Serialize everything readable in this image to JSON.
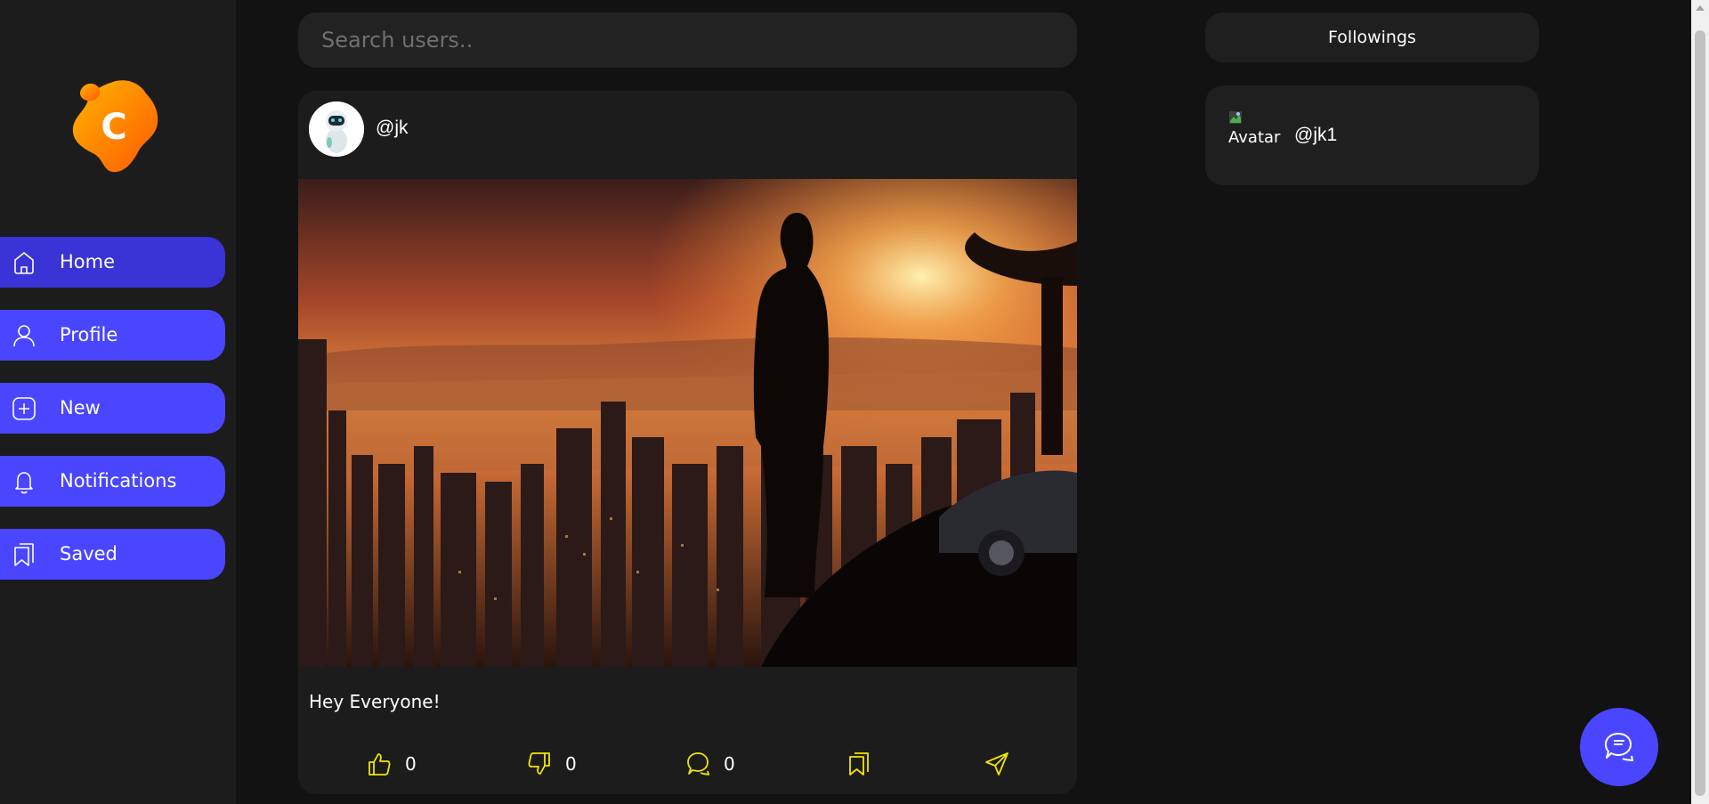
{
  "app": {
    "logo_letter": "C"
  },
  "sidebar": {
    "items": [
      {
        "label": "Home",
        "icon": "home-icon"
      },
      {
        "label": "Profile",
        "icon": "user-icon"
      },
      {
        "label": "New",
        "icon": "plus-square-icon"
      },
      {
        "label": "Notifications",
        "icon": "bell-icon"
      },
      {
        "label": "Saved",
        "icon": "bookmarks-icon"
      }
    ],
    "active": "Home"
  },
  "search": {
    "placeholder": "Search users.."
  },
  "post": {
    "username": "@jk",
    "caption": "Hey Everyone!",
    "likes": "0",
    "dislikes": "0",
    "comments": "0"
  },
  "followings": {
    "title": "Followings",
    "items": [
      {
        "avatar_alt": "Avatar",
        "username": "@jk1"
      }
    ]
  },
  "colors": {
    "accent": "#4a46ff",
    "accent_active": "#3a33d6",
    "action_icon": "#f2e600",
    "background": "#121212",
    "card": "#1c1c1c"
  }
}
